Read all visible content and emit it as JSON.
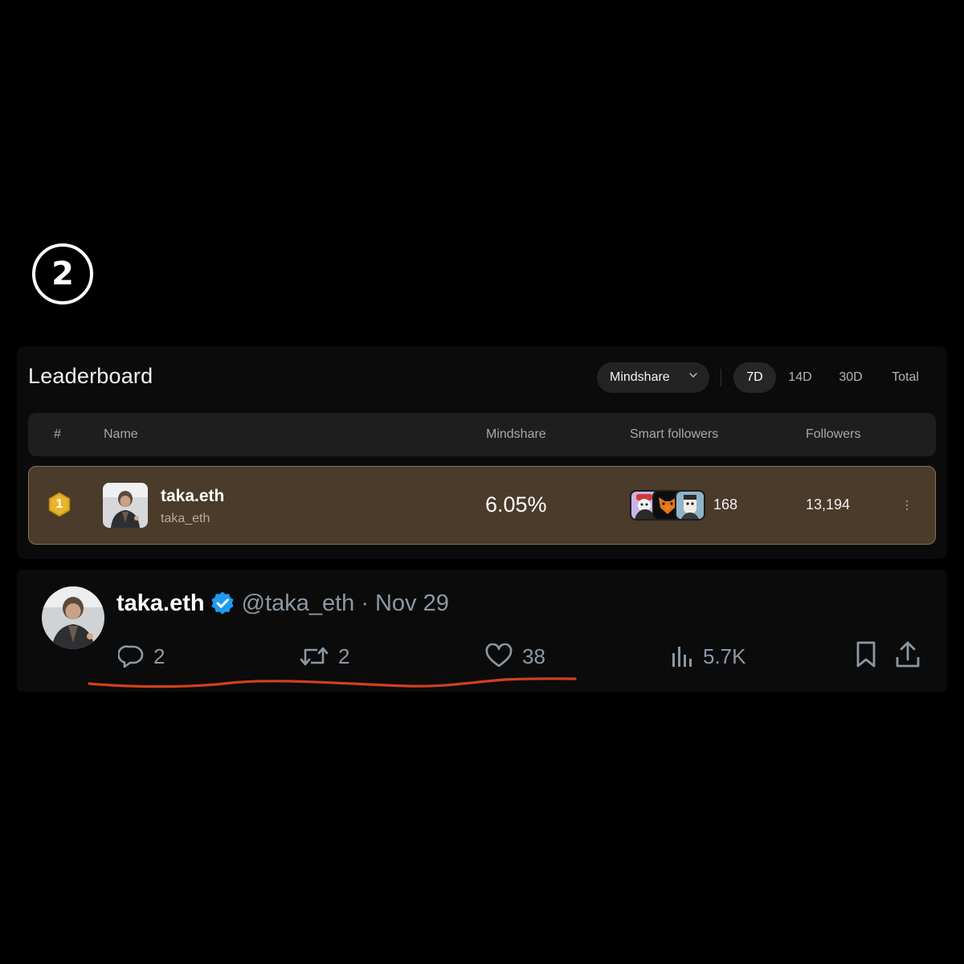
{
  "step": {
    "number": "2"
  },
  "leaderboard": {
    "title": "Leaderboard",
    "metric_select": {
      "selected": "Mindshare",
      "icon": "chevron-down-icon"
    },
    "periods": [
      {
        "label": "7D",
        "active": true
      },
      {
        "label": "14D",
        "active": false
      },
      {
        "label": "30D",
        "active": false
      },
      {
        "label": "Total",
        "active": false
      }
    ],
    "columns": {
      "rank": "#",
      "name": "Name",
      "mindshare": "Mindshare",
      "smart_followers": "Smart followers",
      "followers": "Followers"
    },
    "rows": [
      {
        "rank": "1",
        "display_name": "taka.eth",
        "handle": "taka_eth",
        "mindshare": "6.05%",
        "smart_followers_count": "168",
        "followers": "13,194",
        "row_color": "#4a3b2a",
        "rank_badge_color": "#d9a520"
      }
    ]
  },
  "tweet": {
    "author_name": "taka.eth",
    "verified": true,
    "verified_color": "#1d9bf0",
    "handle": "@taka_eth",
    "separator": "·",
    "date": "Nov 29",
    "replies": "2",
    "reposts": "2",
    "likes": "38",
    "views": "5.7K",
    "icons": [
      "reply-icon",
      "repost-icon",
      "like-icon",
      "views-icon",
      "bookmark-icon",
      "share-icon"
    ]
  },
  "annotation": {
    "underline_color": "#d2401e"
  }
}
